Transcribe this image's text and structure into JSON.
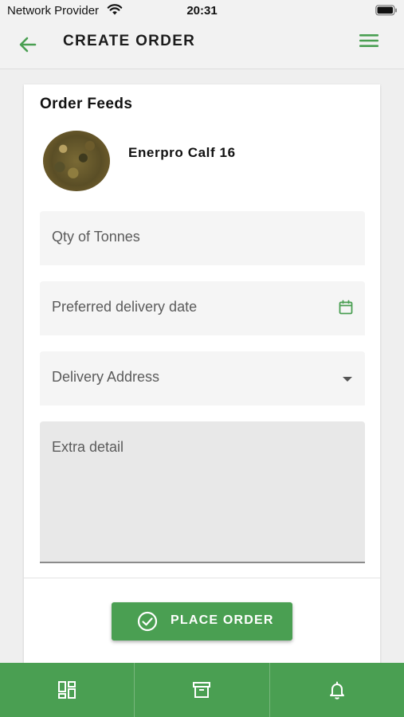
{
  "status_bar": {
    "carrier": "Network Provider",
    "time": "20:31"
  },
  "header": {
    "title": "CREATE ORDER",
    "back_icon": "arrow-left-icon",
    "menu_icon": "hamburger-menu-icon"
  },
  "form": {
    "section_title": "Order Feeds",
    "product": {
      "name": "Enerpro Calf 16"
    },
    "qty_placeholder": "Qty of Tonnes",
    "date_placeholder": "Preferred delivery date",
    "address_placeholder": "Delivery Address",
    "extra_placeholder": "Extra detail",
    "submit_label": "PLACE ORDER"
  },
  "bottom_nav": {
    "tabs": [
      {
        "icon": "dashboard-icon"
      },
      {
        "icon": "archive-icon"
      },
      {
        "icon": "bell-icon"
      }
    ]
  },
  "colors": {
    "accent": "#4a9f52",
    "background": "#efefef",
    "card": "#ffffff"
  }
}
